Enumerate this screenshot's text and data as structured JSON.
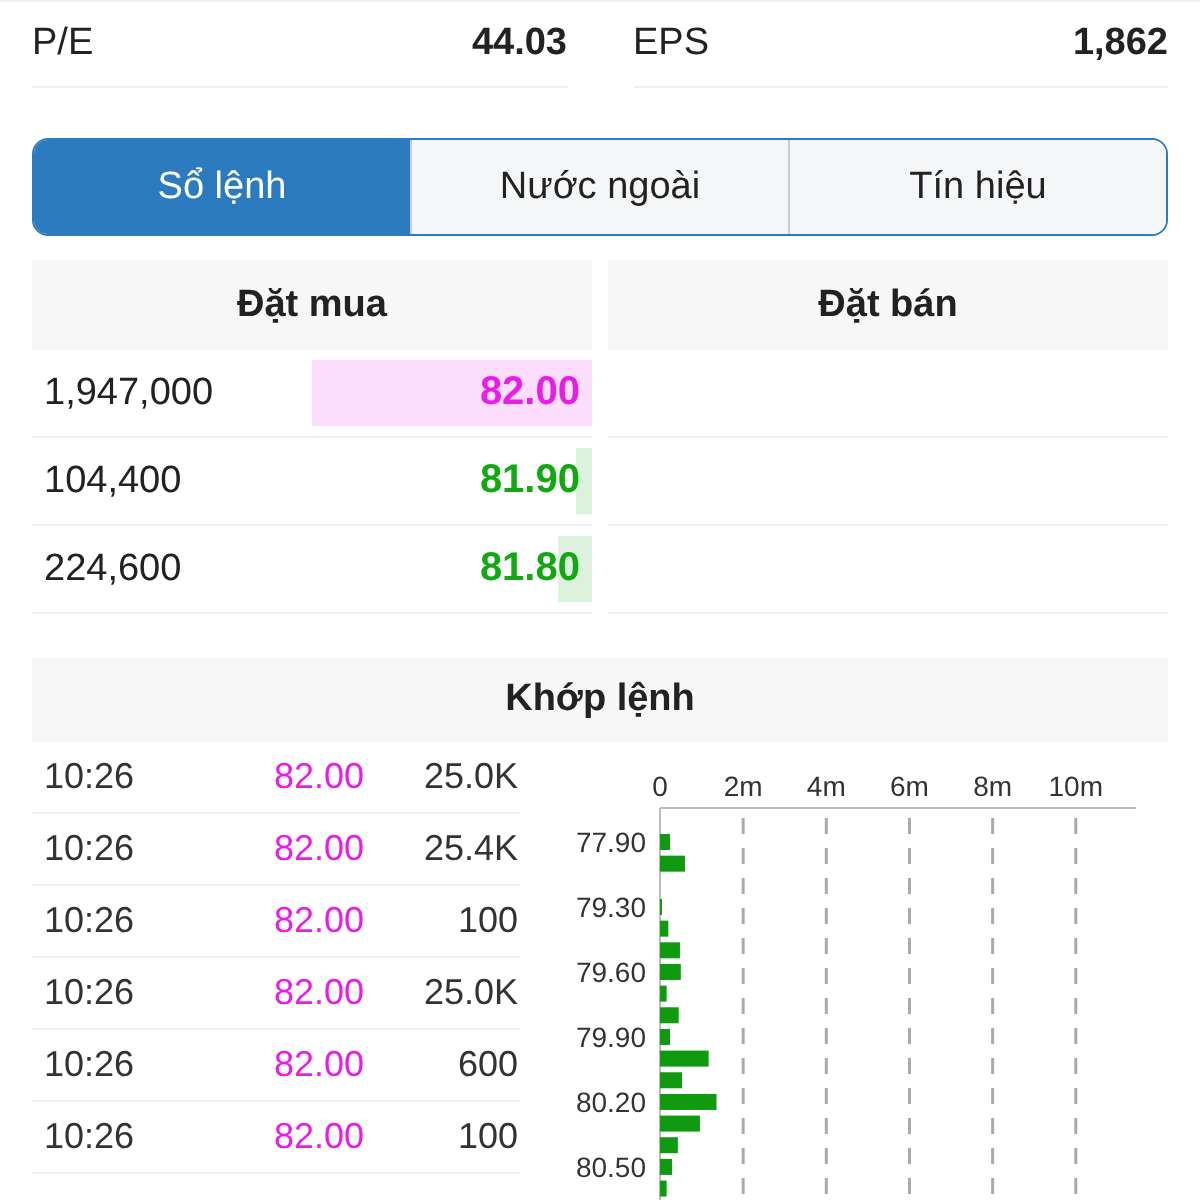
{
  "stats": [
    {
      "label": "P/E",
      "value": "44.03"
    },
    {
      "label": "EPS",
      "value": "1,862"
    }
  ],
  "tabs": [
    {
      "label": "Sổ lệnh",
      "selected": true
    },
    {
      "label": "Nước ngoài",
      "selected": false
    },
    {
      "label": "Tín hiệu",
      "selected": false
    }
  ],
  "order_book": {
    "buy_title": "Đặt mua",
    "sell_title": "Đặt bán",
    "buy_rows": [
      {
        "volume": "1,947,000",
        "price": "82.00",
        "color": "#e81ee8",
        "level": 0.5
      },
      {
        "volume": "104,400",
        "price": "81.90",
        "color": "#12a812",
        "level": 0.03
      },
      {
        "volume": "224,600",
        "price": "81.80",
        "color": "#12a812",
        "level": 0.06
      }
    ]
  },
  "matched": {
    "title": "Khớp lệnh",
    "rows": [
      {
        "time": "10:26",
        "price": "82.00",
        "volume": "25.0K"
      },
      {
        "time": "10:26",
        "price": "82.00",
        "volume": "25.4K"
      },
      {
        "time": "10:26",
        "price": "82.00",
        "volume": "100"
      },
      {
        "time": "10:26",
        "price": "82.00",
        "volume": "25.0K"
      },
      {
        "time": "10:26",
        "price": "82.00",
        "volume": "600"
      },
      {
        "time": "10:26",
        "price": "82.00",
        "volume": "100"
      }
    ],
    "chart_data": {
      "type": "bar",
      "orientation": "horizontal",
      "categories": [
        "77.90",
        null,
        null,
        "79.30",
        null,
        null,
        "79.60",
        null,
        null,
        "79.90",
        null,
        null,
        "80.20",
        null,
        null,
        "80.50",
        null
      ],
      "values": [
        0.24,
        0.6,
        0,
        0.02,
        0.2,
        0.48,
        0.5,
        0.16,
        0.45,
        0.24,
        1.17,
        0.53,
        1.36,
        0.96,
        0.43,
        0.29,
        0.16
      ],
      "xlim": [
        0,
        11.4
      ],
      "grid": true,
      "xticks": [
        {
          "value": 0,
          "label": "0"
        },
        {
          "value": 2,
          "label": "2m"
        },
        {
          "value": 4,
          "label": "4m"
        },
        {
          "value": 6,
          "label": "6m"
        },
        {
          "value": 8,
          "label": "8m"
        },
        {
          "value": 10,
          "label": "10m"
        }
      ]
    }
  }
}
